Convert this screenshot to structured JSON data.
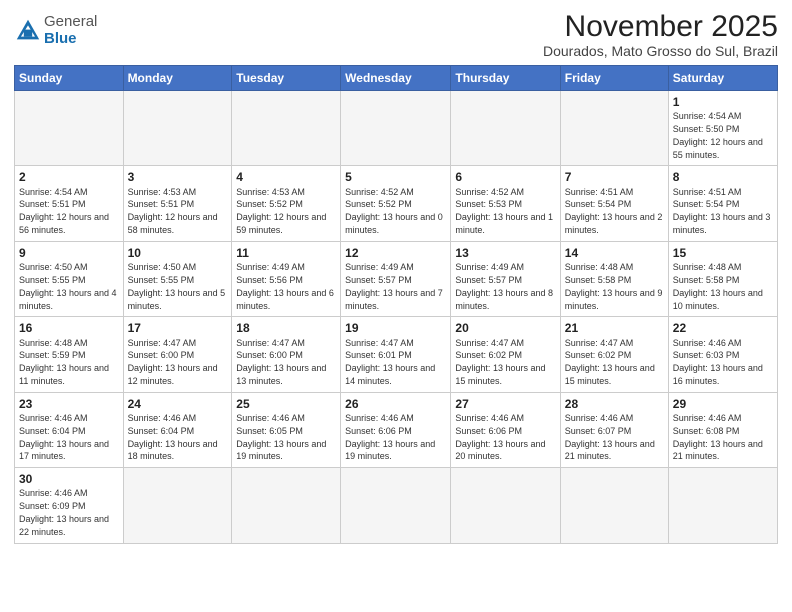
{
  "logo": {
    "general": "General",
    "blue": "Blue"
  },
  "title": "November 2025",
  "location": "Dourados, Mato Grosso do Sul, Brazil",
  "weekdays": [
    "Sunday",
    "Monday",
    "Tuesday",
    "Wednesday",
    "Thursday",
    "Friday",
    "Saturday"
  ],
  "weeks": [
    [
      {
        "day": "",
        "info": ""
      },
      {
        "day": "",
        "info": ""
      },
      {
        "day": "",
        "info": ""
      },
      {
        "day": "",
        "info": ""
      },
      {
        "day": "",
        "info": ""
      },
      {
        "day": "",
        "info": ""
      },
      {
        "day": "1",
        "info": "Sunrise: 4:54 AM\nSunset: 5:50 PM\nDaylight: 12 hours and 55 minutes."
      }
    ],
    [
      {
        "day": "2",
        "info": "Sunrise: 4:54 AM\nSunset: 5:51 PM\nDaylight: 12 hours and 56 minutes."
      },
      {
        "day": "3",
        "info": "Sunrise: 4:53 AM\nSunset: 5:51 PM\nDaylight: 12 hours and 58 minutes."
      },
      {
        "day": "4",
        "info": "Sunrise: 4:53 AM\nSunset: 5:52 PM\nDaylight: 12 hours and 59 minutes."
      },
      {
        "day": "5",
        "info": "Sunrise: 4:52 AM\nSunset: 5:52 PM\nDaylight: 13 hours and 0 minutes."
      },
      {
        "day": "6",
        "info": "Sunrise: 4:52 AM\nSunset: 5:53 PM\nDaylight: 13 hours and 1 minute."
      },
      {
        "day": "7",
        "info": "Sunrise: 4:51 AM\nSunset: 5:54 PM\nDaylight: 13 hours and 2 minutes."
      },
      {
        "day": "8",
        "info": "Sunrise: 4:51 AM\nSunset: 5:54 PM\nDaylight: 13 hours and 3 minutes."
      }
    ],
    [
      {
        "day": "9",
        "info": "Sunrise: 4:50 AM\nSunset: 5:55 PM\nDaylight: 13 hours and 4 minutes."
      },
      {
        "day": "10",
        "info": "Sunrise: 4:50 AM\nSunset: 5:55 PM\nDaylight: 13 hours and 5 minutes."
      },
      {
        "day": "11",
        "info": "Sunrise: 4:49 AM\nSunset: 5:56 PM\nDaylight: 13 hours and 6 minutes."
      },
      {
        "day": "12",
        "info": "Sunrise: 4:49 AM\nSunset: 5:57 PM\nDaylight: 13 hours and 7 minutes."
      },
      {
        "day": "13",
        "info": "Sunrise: 4:49 AM\nSunset: 5:57 PM\nDaylight: 13 hours and 8 minutes."
      },
      {
        "day": "14",
        "info": "Sunrise: 4:48 AM\nSunset: 5:58 PM\nDaylight: 13 hours and 9 minutes."
      },
      {
        "day": "15",
        "info": "Sunrise: 4:48 AM\nSunset: 5:58 PM\nDaylight: 13 hours and 10 minutes."
      }
    ],
    [
      {
        "day": "16",
        "info": "Sunrise: 4:48 AM\nSunset: 5:59 PM\nDaylight: 13 hours and 11 minutes."
      },
      {
        "day": "17",
        "info": "Sunrise: 4:47 AM\nSunset: 6:00 PM\nDaylight: 13 hours and 12 minutes."
      },
      {
        "day": "18",
        "info": "Sunrise: 4:47 AM\nSunset: 6:00 PM\nDaylight: 13 hours and 13 minutes."
      },
      {
        "day": "19",
        "info": "Sunrise: 4:47 AM\nSunset: 6:01 PM\nDaylight: 13 hours and 14 minutes."
      },
      {
        "day": "20",
        "info": "Sunrise: 4:47 AM\nSunset: 6:02 PM\nDaylight: 13 hours and 15 minutes."
      },
      {
        "day": "21",
        "info": "Sunrise: 4:47 AM\nSunset: 6:02 PM\nDaylight: 13 hours and 15 minutes."
      },
      {
        "day": "22",
        "info": "Sunrise: 4:46 AM\nSunset: 6:03 PM\nDaylight: 13 hours and 16 minutes."
      }
    ],
    [
      {
        "day": "23",
        "info": "Sunrise: 4:46 AM\nSunset: 6:04 PM\nDaylight: 13 hours and 17 minutes."
      },
      {
        "day": "24",
        "info": "Sunrise: 4:46 AM\nSunset: 6:04 PM\nDaylight: 13 hours and 18 minutes."
      },
      {
        "day": "25",
        "info": "Sunrise: 4:46 AM\nSunset: 6:05 PM\nDaylight: 13 hours and 19 minutes."
      },
      {
        "day": "26",
        "info": "Sunrise: 4:46 AM\nSunset: 6:06 PM\nDaylight: 13 hours and 19 minutes."
      },
      {
        "day": "27",
        "info": "Sunrise: 4:46 AM\nSunset: 6:06 PM\nDaylight: 13 hours and 20 minutes."
      },
      {
        "day": "28",
        "info": "Sunrise: 4:46 AM\nSunset: 6:07 PM\nDaylight: 13 hours and 21 minutes."
      },
      {
        "day": "29",
        "info": "Sunrise: 4:46 AM\nSunset: 6:08 PM\nDaylight: 13 hours and 21 minutes."
      }
    ],
    [
      {
        "day": "30",
        "info": "Sunrise: 4:46 AM\nSunset: 6:09 PM\nDaylight: 13 hours and 22 minutes."
      },
      {
        "day": "",
        "info": ""
      },
      {
        "day": "",
        "info": ""
      },
      {
        "day": "",
        "info": ""
      },
      {
        "day": "",
        "info": ""
      },
      {
        "day": "",
        "info": ""
      },
      {
        "day": "",
        "info": ""
      }
    ]
  ]
}
